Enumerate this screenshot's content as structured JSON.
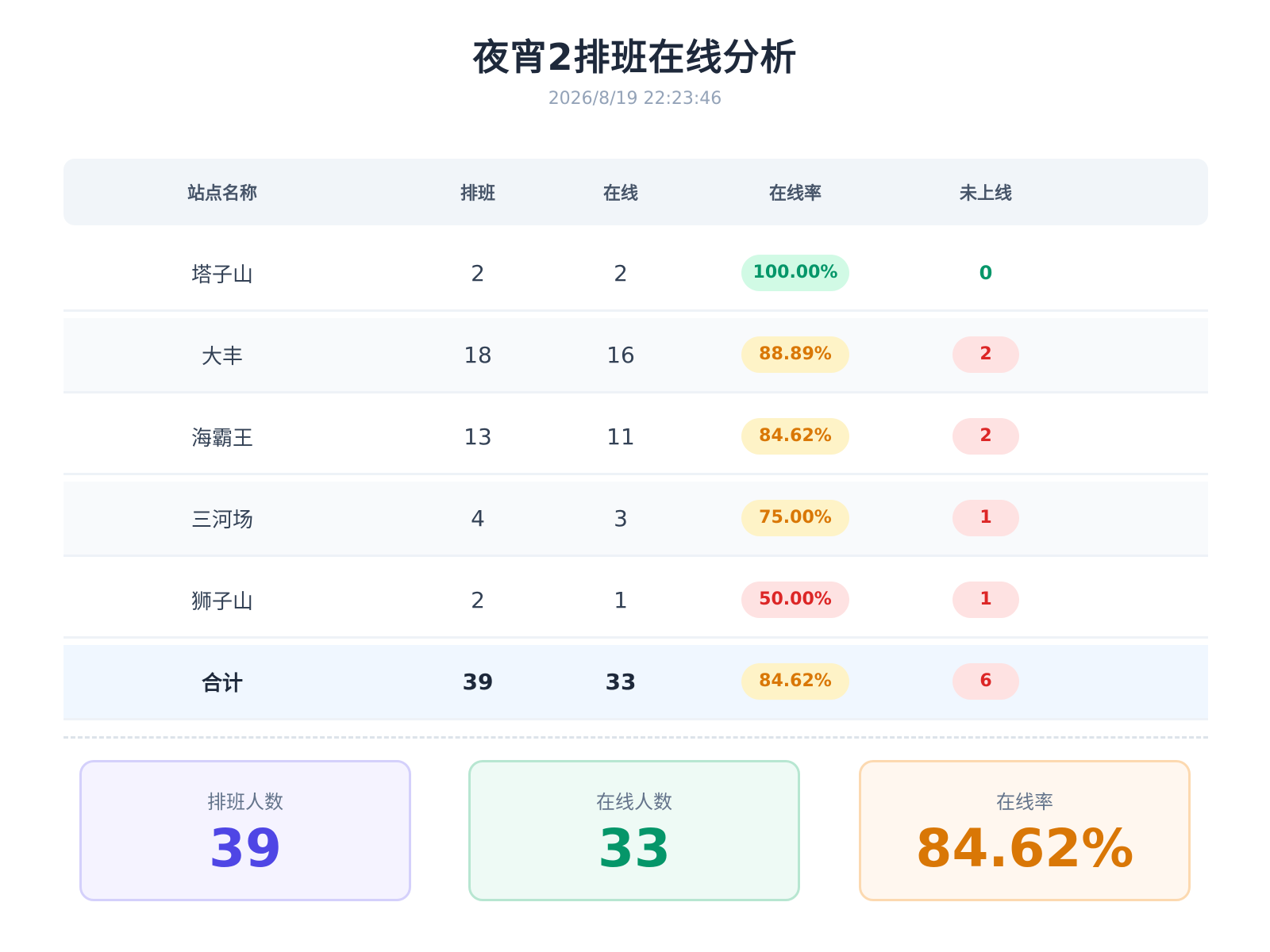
{
  "header": {
    "title": "夜宵2排班在线分析",
    "timestamp": "2026/8/19 22:23:46"
  },
  "table": {
    "columns": [
      "站点名称",
      "排班",
      "在线",
      "在线率",
      "未上线"
    ],
    "rows": [
      {
        "name": "塔子山",
        "scheduled": "2",
        "online": "2",
        "rate": "100.00%",
        "rate_status": "green",
        "offline": "0",
        "offline_status": "zero"
      },
      {
        "name": "大丰",
        "scheduled": "18",
        "online": "16",
        "rate": "88.89%",
        "rate_status": "amber",
        "offline": "2",
        "offline_status": "red"
      },
      {
        "name": "海霸王",
        "scheduled": "13",
        "online": "11",
        "rate": "84.62%",
        "rate_status": "amber",
        "offline": "2",
        "offline_status": "red"
      },
      {
        "name": "三河场",
        "scheduled": "4",
        "online": "3",
        "rate": "75.00%",
        "rate_status": "amber",
        "offline": "1",
        "offline_status": "red"
      },
      {
        "name": "狮子山",
        "scheduled": "2",
        "online": "1",
        "rate": "50.00%",
        "rate_status": "red",
        "offline": "1",
        "offline_status": "red"
      }
    ],
    "total": {
      "name": "合计",
      "scheduled": "39",
      "online": "33",
      "rate": "84.62%",
      "rate_status": "amber",
      "offline": "6",
      "offline_status": "red"
    }
  },
  "summary": {
    "scheduled": {
      "label": "排班人数",
      "value": "39"
    },
    "online": {
      "label": "在线人数",
      "value": "33"
    },
    "rate": {
      "label": "在线率",
      "value": "84.62%"
    }
  },
  "colors": {
    "green": "#059669",
    "amber": "#d97706",
    "red": "#dc2626",
    "indigo": "#4f46e5"
  }
}
